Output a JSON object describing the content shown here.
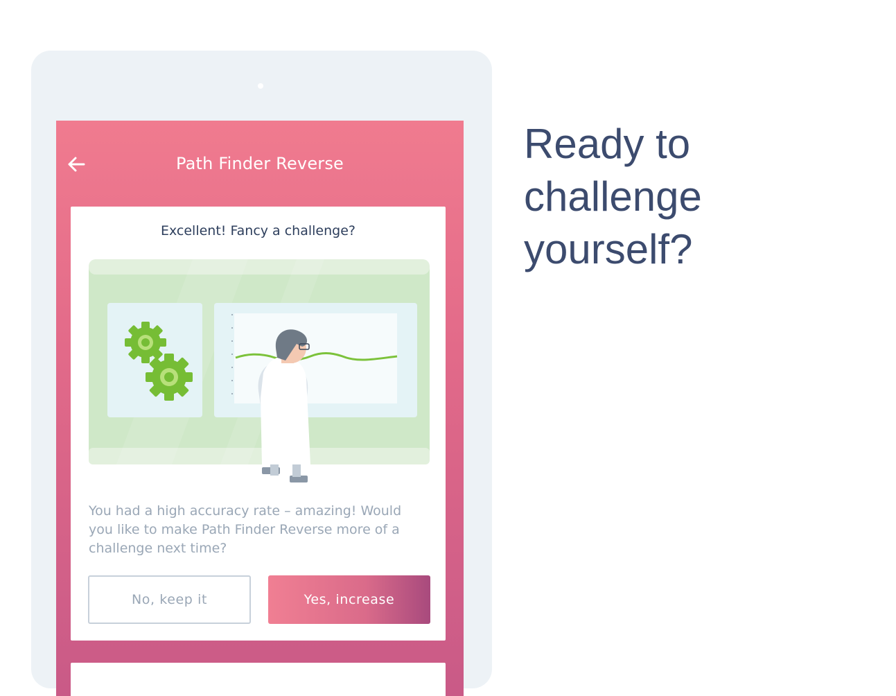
{
  "app": {
    "title": "Path Finder Reverse"
  },
  "dialog": {
    "heading": "Excellent! Fancy a challenge?",
    "body": "You had a high accuracy rate – amazing! Would you like to make Path Finder Reverse more of a challenge next time?",
    "no_button": "No, keep it",
    "yes_button": "Yes, increase"
  },
  "promo": {
    "headline_lines": [
      "Ready to",
      "challenge",
      "yourself?"
    ]
  },
  "icons": {
    "back": "arrow-left-icon",
    "gears": "gears-icon"
  },
  "colors": {
    "header_gradient_top": "#f07b8f",
    "header_gradient_bottom": "#c95a87",
    "headline_text": "#3c4b6e",
    "body_text": "#9aa7b6",
    "tablet_frame": "#edf2f6",
    "illustration_green": "#cfe8c8",
    "gear_green": "#7cc23b"
  }
}
